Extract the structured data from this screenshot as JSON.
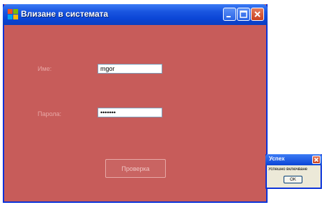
{
  "main_window": {
    "title": "Влизане в системата",
    "icon": "application-icon",
    "background_color": "#c75c5a",
    "controls": [
      "minimize-icon",
      "maximize-icon",
      "close-icon"
    ],
    "username": {
      "label": "Име:",
      "value": "mgor"
    },
    "password": {
      "label": "Парола:",
      "value": "•••••••"
    },
    "check_button": "Проверка"
  },
  "message_dialog": {
    "title": "Успех",
    "message": "Успешно включване",
    "ok_button": "OK"
  }
}
